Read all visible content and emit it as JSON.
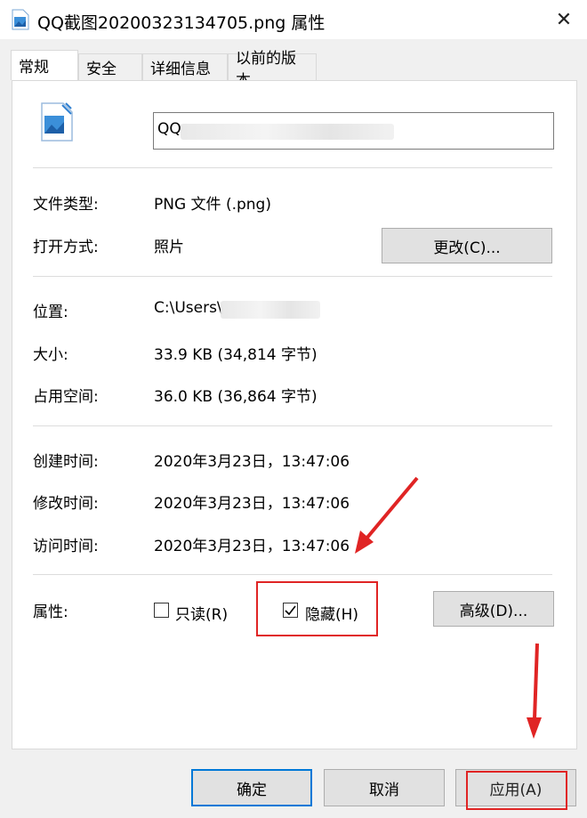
{
  "window": {
    "title": "QQ截图20200323134705.png 属性",
    "close_symbol": "✕"
  },
  "tabs": [
    {
      "label": "常规",
      "active": true
    },
    {
      "label": "安全"
    },
    {
      "label": "详细信息"
    },
    {
      "label": "以前的版本"
    }
  ],
  "general": {
    "filename_visible": "QQ",
    "file_type_label": "文件类型:",
    "file_type_value": "PNG 文件 (.png)",
    "opens_with_label": "打开方式:",
    "opens_with_value": "照片",
    "change_button": "更改(C)...",
    "location_label": "位置:",
    "location_value": "C:\\Users\\",
    "size_label": "大小:",
    "size_value": "33.9 KB (34,814 字节)",
    "disk_size_label": "占用空间:",
    "disk_size_value": "36.0 KB (36,864 字节)",
    "created_label": "创建时间:",
    "created_value": "2020年3月23日，13:47:06",
    "modified_label": "修改时间:",
    "modified_value": "2020年3月23日，13:47:06",
    "accessed_label": "访问时间:",
    "accessed_value": "2020年3月23日，13:47:06",
    "attributes_label": "属性:",
    "readonly_label": "只读(R)",
    "readonly_checked": false,
    "hidden_label": "隐藏(H)",
    "hidden_checked": true,
    "advanced_button": "高级(D)..."
  },
  "footer": {
    "ok": "确定",
    "cancel": "取消",
    "apply": "应用(A)"
  },
  "colors": {
    "annotation": "#e02424",
    "accent": "#0078d7"
  }
}
